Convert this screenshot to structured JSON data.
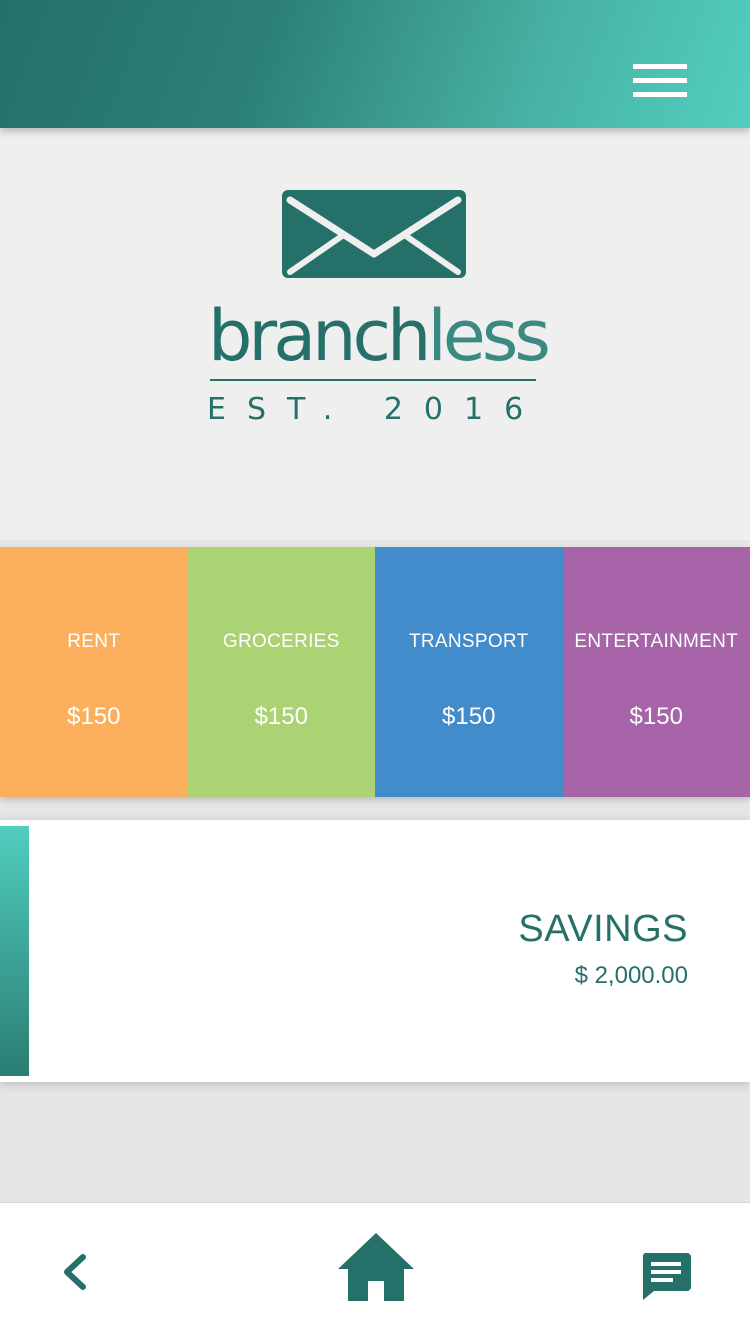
{
  "header": {
    "menu_icon": "hamburger-menu-icon"
  },
  "brand": {
    "logo_icon": "envelope-icon",
    "name_bold": "branch",
    "name_light": "less",
    "established": "EST. 2016"
  },
  "categories": [
    {
      "label": "RENT",
      "amount": "$150",
      "color": "#fbaf5d"
    },
    {
      "label": "GROCERIES",
      "amount": "$150",
      "color": "#acd373"
    },
    {
      "label": "TRANSPORT",
      "amount": "$150",
      "color": "#438ccb"
    },
    {
      "label": "ENTERTAINMENT",
      "amount": "$150",
      "color": "#a864a8"
    }
  ],
  "savings": {
    "title": "SAVINGS",
    "amount": "$ 2,000.00"
  },
  "bottom_nav": {
    "back_icon": "chevron-left-icon",
    "home_icon": "home-icon",
    "chat_icon": "chat-icon"
  },
  "colors": {
    "primary": "#26706a",
    "accent": "#52cfbf",
    "background": "#efefef"
  }
}
